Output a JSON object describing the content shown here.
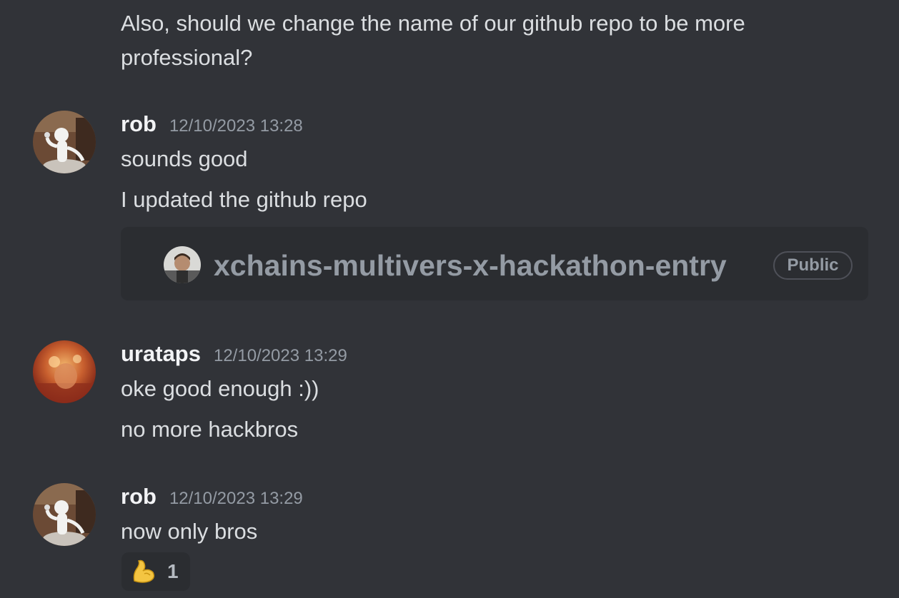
{
  "colors": {
    "background": "#313338",
    "text": "#dbdee1",
    "username": "#f2f3f5",
    "timestamp": "#949ba4",
    "embed_background": "#2b2d31"
  },
  "top_message": {
    "line1": "Also, should we change the name of our github repo to be more",
    "line2": "professional?"
  },
  "messages": [
    {
      "author": "rob",
      "timestamp": "12/10/2023 13:28",
      "lines": [
        "sounds good",
        "I updated the github repo"
      ],
      "embed": {
        "repo_name": "xchains-multivers-x-hackathon-entry",
        "visibility": "Public"
      }
    },
    {
      "author": "urataps",
      "timestamp": "12/10/2023 13:29",
      "lines": [
        "oke good enough :))",
        "no more hackbros"
      ]
    },
    {
      "author": "rob",
      "timestamp": "12/10/2023 13:29",
      "lines": [
        "now only bros"
      ],
      "reaction": {
        "icon": "flexed-biceps-icon",
        "count": "1"
      }
    }
  ]
}
